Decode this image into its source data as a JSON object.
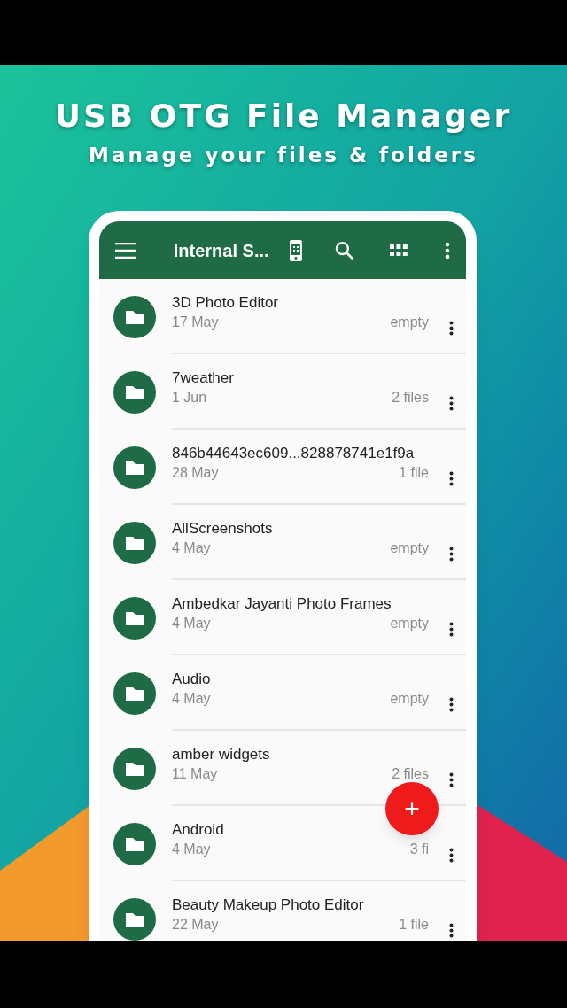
{
  "headline": "USB OTG File Manager",
  "tagline": "Manage your files & folders",
  "app_bar": {
    "title": "Internal S..."
  },
  "folders": [
    {
      "name": "3D Photo Editor",
      "date": "17 May",
      "count": "empty"
    },
    {
      "name": "7weather",
      "date": "1 Jun",
      "count": "2 files"
    },
    {
      "name": "846b44643ec609...828878741e1f9a",
      "date": "28 May",
      "count": "1 file"
    },
    {
      "name": "AllScreenshots",
      "date": "4 May",
      "count": "empty"
    },
    {
      "name": "Ambedkar Jayanti Photo Frames",
      "date": "4 May",
      "count": "empty"
    },
    {
      "name": "Audio",
      "date": "4 May",
      "count": "empty"
    },
    {
      "name": "amber widgets",
      "date": "11 May",
      "count": "2 files"
    },
    {
      "name": "Android",
      "date": "4 May",
      "count": "3 fi"
    },
    {
      "name": "Beauty Makeup Photo Editor",
      "date": "22 May",
      "count": "1 file"
    }
  ],
  "fab": {
    "label": "+"
  }
}
